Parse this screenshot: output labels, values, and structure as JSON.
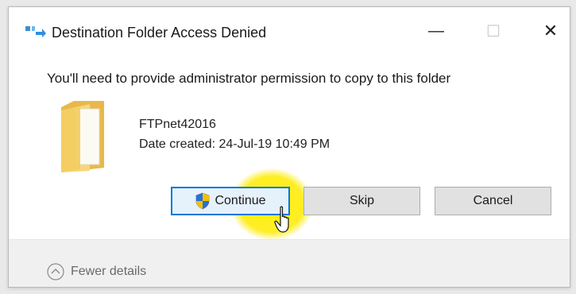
{
  "dialog": {
    "title": "Destination Folder Access Denied",
    "window_buttons": {
      "minimize": "—",
      "maximize": "☐",
      "close": "✕"
    },
    "message": "You'll need to provide administrator permission to copy to this folder",
    "item": {
      "name": "FTPnet42016",
      "date_created": "Date created: 24-Jul-19 10:49 PM",
      "icon": "folder-icon"
    },
    "buttons": {
      "continue": "Continue",
      "skip": "Skip",
      "cancel": "Cancel"
    },
    "footer": {
      "toggle_label": "Fewer details"
    }
  },
  "colors": {
    "accent": "#0078d7",
    "highlight": "#ffef00",
    "folder": "#f2c94c"
  }
}
